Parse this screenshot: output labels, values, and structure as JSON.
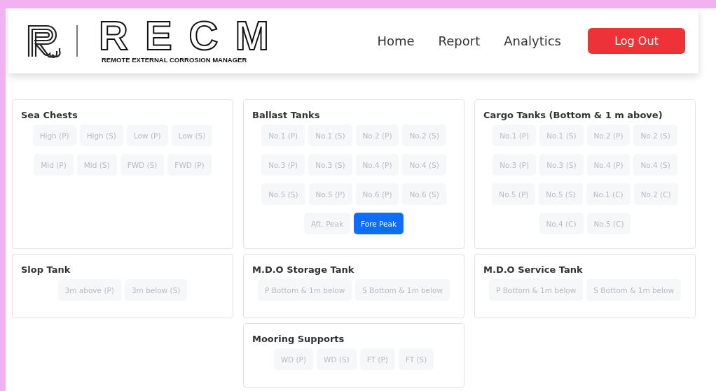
{
  "header": {
    "brand": "RECM",
    "tagline": "REMOTE EXTERNAL CORROSION MANAGER",
    "nav": [
      {
        "label": "Home",
        "kind": "link"
      },
      {
        "label": "Report",
        "kind": "link"
      },
      {
        "label": "Analytics",
        "kind": "link"
      },
      {
        "label": "Log Out",
        "kind": "button"
      }
    ]
  },
  "columns": [
    [
      {
        "title": "Sea Chests",
        "buttons": [
          {
            "label": "High (P)",
            "selected": false
          },
          {
            "label": "High (S)",
            "selected": false
          },
          {
            "label": "Low (P)",
            "selected": false
          },
          {
            "label": "Low (S)",
            "selected": false
          },
          {
            "label": "Mid (P)",
            "selected": false
          },
          {
            "label": "Mid (S)",
            "selected": false
          },
          {
            "label": "FWD (S)",
            "selected": false
          },
          {
            "label": "FWD (P)",
            "selected": false
          }
        ]
      },
      {
        "title": "Slop Tank",
        "buttons": [
          {
            "label": "3m above (P)",
            "selected": false
          },
          {
            "label": "3m below (S)",
            "selected": false
          }
        ]
      }
    ],
    [
      {
        "title": "Ballast Tanks",
        "buttons": [
          {
            "label": "No.1 (P)",
            "selected": false
          },
          {
            "label": "No.1 (S)",
            "selected": false
          },
          {
            "label": "No.2 (P)",
            "selected": false
          },
          {
            "label": "No.2 (S)",
            "selected": false
          },
          {
            "label": "No.3 (P)",
            "selected": false
          },
          {
            "label": "No.3 (S)",
            "selected": false
          },
          {
            "label": "No.4 (P)",
            "selected": false
          },
          {
            "label": "No.4 (S)",
            "selected": false
          },
          {
            "label": "No.5 (S)",
            "selected": false
          },
          {
            "label": "No.5 (P)",
            "selected": false
          },
          {
            "label": "No.6 (P)",
            "selected": false
          },
          {
            "label": "No.6 (S)",
            "selected": false
          },
          {
            "label": "Aft. Peak",
            "selected": false
          },
          {
            "label": "Fore Peak",
            "selected": true
          }
        ]
      },
      {
        "title": "M.D.O Storage Tank",
        "buttons": [
          {
            "label": "P Bottom & 1m below",
            "selected": false
          },
          {
            "label": "S Bottom & 1m below",
            "selected": false
          }
        ]
      },
      {
        "title": "Mooring Supports",
        "buttons": [
          {
            "label": "WD (P)",
            "selected": false
          },
          {
            "label": "WD (S)",
            "selected": false
          },
          {
            "label": "FT (P)",
            "selected": false
          },
          {
            "label": "FT (S)",
            "selected": false
          }
        ]
      }
    ],
    [
      {
        "title": "Cargo Tanks (Bottom & 1 m above)",
        "buttons": [
          {
            "label": "No.1 (P)",
            "selected": false
          },
          {
            "label": "No.1 (S)",
            "selected": false
          },
          {
            "label": "No.2 (P)",
            "selected": false
          },
          {
            "label": "No.2 (S)",
            "selected": false
          },
          {
            "label": "No.3 (P)",
            "selected": false
          },
          {
            "label": "No.3 (S)",
            "selected": false
          },
          {
            "label": "No.4 (P)",
            "selected": false
          },
          {
            "label": "No.4 (S)",
            "selected": false
          },
          {
            "label": "No.5 (P)",
            "selected": false
          },
          {
            "label": "No.5 (S)",
            "selected": false
          },
          {
            "label": "No.1 (C)",
            "selected": false
          },
          {
            "label": "No.2 (C)",
            "selected": false
          },
          {
            "label": "No.4 (C)",
            "selected": false
          },
          {
            "label": "No.5 (C)",
            "selected": false
          }
        ]
      },
      {
        "title": "M.D.O Service Tank",
        "buttons": [
          {
            "label": "P Bottom & 1m below",
            "selected": false
          },
          {
            "label": "S Bottom & 1m below",
            "selected": false
          }
        ]
      }
    ]
  ]
}
